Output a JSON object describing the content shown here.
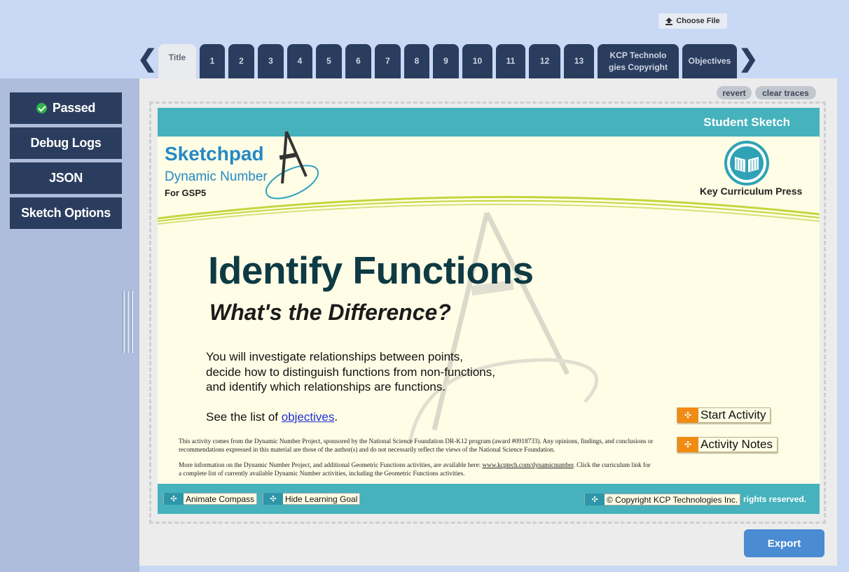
{
  "toolbar": {
    "choose_file_label": "Choose File"
  },
  "tabs": [
    "Title",
    "1",
    "2",
    "3",
    "4",
    "5",
    "6",
    "7",
    "8",
    "9",
    "10",
    "11",
    "12",
    "13",
    "KCP Technologies Copyright",
    "Objectives"
  ],
  "tab_display": {
    "kcp_line1": "KCP Technolo",
    "kcp_line2": "gies Copyright"
  },
  "active_tab": "Title",
  "sidebar": {
    "passed_label": "Passed",
    "debug_label": "Debug Logs",
    "json_label": "JSON",
    "sketch_options_label": "Sketch Options"
  },
  "main": {
    "revert_label": "revert",
    "clear_traces_label": "clear traces",
    "export_label": "Export"
  },
  "sketch": {
    "student_sketch": "Student Sketch",
    "brand_title": "Sketchpad",
    "brand_subtitle": "Dynamic Number",
    "brand_for": "For GSP5",
    "publisher": "Key Curriculum Press",
    "title": "Identify Functions",
    "subtitle": "What's the Difference?",
    "desc_line1": "You will investigate relationships between points,",
    "desc_line2": "decide how to distinguish functions from non-functions,",
    "desc_line3": "and identify which relationships are functions.",
    "see_prefix": "See the list of ",
    "see_link": "objectives",
    "see_suffix": ".",
    "fine_print_1": "This activity comes from the Dynamic Number Project, sponsored by the National Science Foundation DR-K12 program (award #0918733). Any opinions, findings, and conclusions or recommendations expressed in this material are those of the author(s) and do not necessarily reflect the views of the National Science Foundation.",
    "fine_print_2_prefix": "More information on the Dynamic Number Project, and additional Geometric Functions activities, are available here: ",
    "fine_print_2_link": "www.kcptech.com/dynamicnumber",
    "fine_print_2_suffix": ". Click the curriculum link for a complete list of currently available Dynamic Number activities, including the Geometric Functions activities.",
    "start_activity": "Start Activity",
    "activity_notes": "Activity Notes",
    "animate_compass": "Animate Compass",
    "hide_learning_goal": "Hide Learning Goal",
    "copyright": "© Copyright KCP Technologies Inc.",
    "rights_tail": "ll rights reserved."
  },
  "colors": {
    "page_bg": "#c9d8f4",
    "tab_bg": "#2b3d5f",
    "teal": "#45b2bd",
    "brand_blue": "#2589c5",
    "title_dark": "#0e3a44",
    "orange": "#f08c14",
    "export_blue": "#4a8bd1"
  },
  "icons": [
    "upload-icon",
    "chevron-left-icon",
    "chevron-right-icon",
    "checkmark-icon",
    "compass-logo",
    "book-logo",
    "plus-icon",
    "resize-grip-icon"
  ]
}
